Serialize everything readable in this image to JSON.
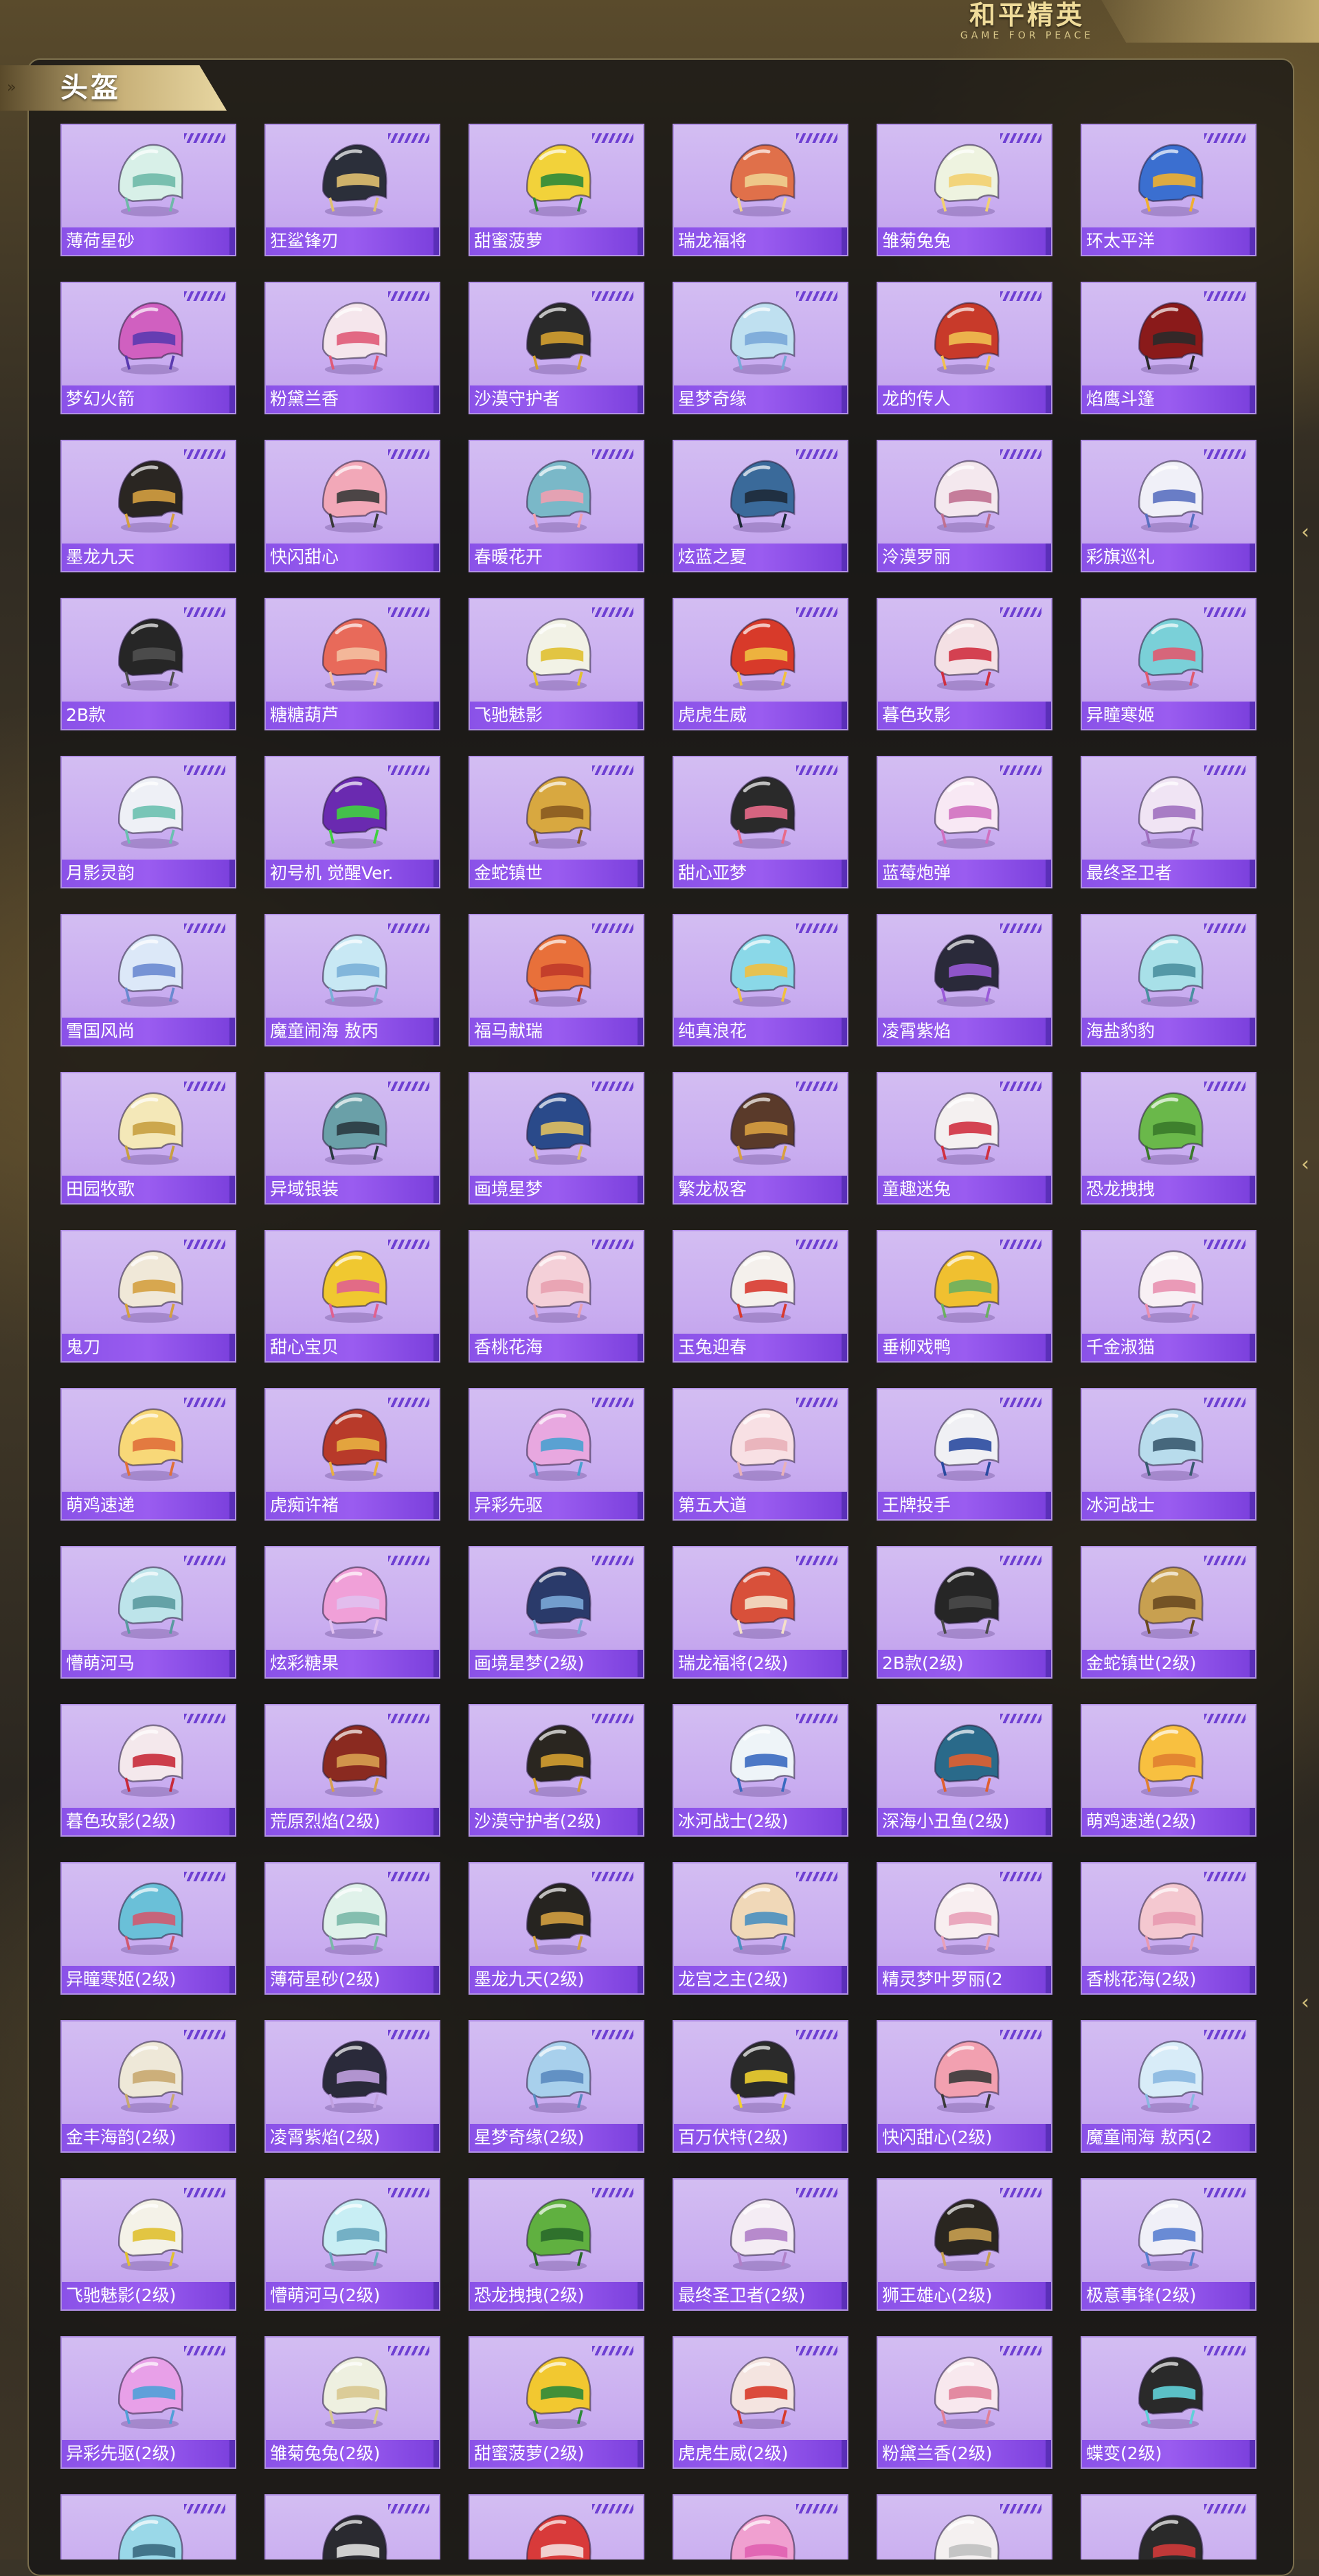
{
  "brand": {
    "logo_text": "和平精英",
    "logo_subtitle": "GAME FOR PEACE"
  },
  "section": {
    "title": "头盔"
  },
  "colors": {
    "card_bg": "#d3bdf2",
    "label_bar": "#8a52e8",
    "panel_border": "#c8b478",
    "tab_gold": "#c9b27a"
  },
  "items": [
    {
      "name": "薄荷星砂",
      "icon": "helmet-icon",
      "color": "#d8f0e8",
      "accent": "#6fb9a8"
    },
    {
      "name": "狂鲨锋刃",
      "icon": "helmet-icon",
      "color": "#2b2f3a",
      "accent": "#e0c070"
    },
    {
      "name": "甜蜜菠萝",
      "icon": "helmet-icon",
      "color": "#f2d23a",
      "accent": "#2e8a3a"
    },
    {
      "name": "瑞龙福将",
      "icon": "helmet-icon",
      "color": "#e0704a",
      "accent": "#f0d090"
    },
    {
      "name": "雏菊兔兔",
      "icon": "helmet-icon",
      "color": "#eef3e0",
      "accent": "#f2d070"
    },
    {
      "name": "环太平洋",
      "icon": "helmet-icon",
      "color": "#3b6fd0",
      "accent": "#f0b030"
    },
    {
      "name": "梦幻火箭",
      "icon": "helmet-icon",
      "color": "#d060c0",
      "accent": "#5a3ab0"
    },
    {
      "name": "粉黛兰香",
      "icon": "helmet-icon",
      "color": "#f5e6ec",
      "accent": "#e05a78"
    },
    {
      "name": "沙漠守护者",
      "icon": "helmet-icon",
      "color": "#2a2a2a",
      "accent": "#d4a030"
    },
    {
      "name": "星梦奇缘",
      "icon": "helmet-icon",
      "color": "#bfe0f0",
      "accent": "#7aa8d8"
    },
    {
      "name": "龙的传人",
      "icon": "helmet-icon",
      "color": "#c83a2a",
      "accent": "#f0c050"
    },
    {
      "name": "焰鹰斗篷",
      "icon": "helmet-icon",
      "color": "#8a1a1a",
      "accent": "#2a2a2a"
    },
    {
      "name": "墨龙九天",
      "icon": "helmet-icon",
      "color": "#2a2622",
      "accent": "#d4a040"
    },
    {
      "name": "快闪甜心",
      "icon": "helmet-icon",
      "color": "#f2a8b8",
      "accent": "#3a3a3a"
    },
    {
      "name": "春暖花开",
      "icon": "helmet-icon",
      "color": "#7ab8c8",
      "accent": "#f0a0b0"
    },
    {
      "name": "炫蓝之夏",
      "icon": "helmet-icon",
      "color": "#3a6a9a",
      "accent": "#1e2a38"
    },
    {
      "name": "泠漠罗丽",
      "icon": "helmet-icon",
      "color": "#f4e8ee",
      "accent": "#c07090"
    },
    {
      "name": "彩旗巡礼",
      "icon": "helmet-icon",
      "color": "#f0f0f8",
      "accent": "#5a70c0"
    },
    {
      "name": "2B款",
      "icon": "helmet-icon",
      "color": "#262626",
      "accent": "#505050"
    },
    {
      "name": "糖糖葫芦",
      "icon": "helmet-icon",
      "color": "#e86a5a",
      "accent": "#f4c0a0"
    },
    {
      "name": "飞驰魅影",
      "icon": "helmet-icon",
      "color": "#f2f2e6",
      "accent": "#e0c030"
    },
    {
      "name": "虎虎生威",
      "icon": "helmet-icon",
      "color": "#d83a2a",
      "accent": "#f0c040"
    },
    {
      "name": "暮色玫影",
      "icon": "helmet-icon",
      "color": "#f4e0e4",
      "accent": "#d03040"
    },
    {
      "name": "异瞳寒姬",
      "icon": "helmet-icon",
      "color": "#7ad0d8",
      "accent": "#e05a70"
    },
    {
      "name": "月影灵韵",
      "icon": "helmet-icon",
      "color": "#eef0f6",
      "accent": "#6ac0b0"
    },
    {
      "name": "初号机 觉醒Ver.",
      "icon": "helmet-icon",
      "color": "#6a2ab0",
      "accent": "#40d040"
    },
    {
      "name": "金蛇镇世",
      "icon": "helmet-icon",
      "color": "#d8a840",
      "accent": "#8a5a20"
    },
    {
      "name": "甜心亚梦",
      "icon": "helmet-icon",
      "color": "#2a2a2a",
      "accent": "#e86a8a"
    },
    {
      "name": "蓝莓炮弹",
      "icon": "helmet-icon",
      "color": "#f8e8f4",
      "accent": "#d070c0"
    },
    {
      "name": "最终圣卫者",
      "icon": "helmet-icon",
      "color": "#f0e4f4",
      "accent": "#a070c0"
    },
    {
      "name": "雪国风尚",
      "icon": "helmet-icon",
      "color": "#dce8f8",
      "accent": "#6a8ad0"
    },
    {
      "name": "魔童闹海 敖丙",
      "icon": "helmet-icon",
      "color": "#c8e8f4",
      "accent": "#7ab0d8"
    },
    {
      "name": "福马献瑞",
      "icon": "helmet-icon",
      "color": "#e8703a",
      "accent": "#c03a2a"
    },
    {
      "name": "纯真浪花",
      "icon": "helmet-icon",
      "color": "#8ad8e8",
      "accent": "#f0c040"
    },
    {
      "name": "凌霄紫焰",
      "icon": "helmet-icon",
      "color": "#2a2a3a",
      "accent": "#9a5ad8"
    },
    {
      "name": "海盐豹豹",
      "icon": "helmet-icon",
      "color": "#a8e0e8",
      "accent": "#4a90a0"
    },
    {
      "name": "田园牧歌",
      "icon": "helmet-icon",
      "color": "#f4e8b8",
      "accent": "#c8a040"
    },
    {
      "name": "异域银装",
      "icon": "helmet-icon",
      "color": "#6aa0a8",
      "accent": "#2a3a40"
    },
    {
      "name": "画境星梦",
      "icon": "helmet-icon",
      "color": "#2a4a8a",
      "accent": "#e0c060"
    },
    {
      "name": "繁龙极客",
      "icon": "helmet-icon",
      "color": "#5a3a2a",
      "accent": "#d8a040"
    },
    {
      "name": "童趣迷兔",
      "icon": "helmet-icon",
      "color": "#f4f0f0",
      "accent": "#d03040"
    },
    {
      "name": "恐龙拽拽",
      "icon": "helmet-icon",
      "color": "#6ab84a",
      "accent": "#3a7a2a"
    },
    {
      "name": "鬼刀",
      "icon": "helmet-icon",
      "color": "#f0e8d8",
      "accent": "#d4a040"
    },
    {
      "name": "甜心宝贝",
      "icon": "helmet-icon",
      "color": "#f0c830",
      "accent": "#e06090"
    },
    {
      "name": "香桃花海",
      "icon": "helmet-icon",
      "color": "#f4d0d8",
      "accent": "#e8a0b0"
    },
    {
      "name": "玉兔迎春",
      "icon": "helmet-icon",
      "color": "#f4f0ec",
      "accent": "#d83a30"
    },
    {
      "name": "垂柳戏鸭",
      "icon": "helmet-icon",
      "color": "#f0c030",
      "accent": "#6ab060"
    },
    {
      "name": "千金淑猫",
      "icon": "helmet-icon",
      "color": "#f8f0f4",
      "accent": "#e890b0"
    },
    {
      "name": "萌鸡速递",
      "icon": "helmet-icon",
      "color": "#f8d878",
      "accent": "#e0703a"
    },
    {
      "name": "虎痴许褚",
      "icon": "helmet-icon",
      "color": "#b83a2a",
      "accent": "#e8b040"
    },
    {
      "name": "异彩先驱",
      "icon": "helmet-icon",
      "color": "#e8a8e0",
      "accent": "#4aa0d0"
    },
    {
      "name": "第五大道",
      "icon": "helmet-icon",
      "color": "#f8e0e4",
      "accent": "#e8b0b8"
    },
    {
      "name": "王牌投手",
      "icon": "helmet-icon",
      "color": "#f0f0f4",
      "accent": "#2a4aa0"
    },
    {
      "name": "冰河战士",
      "icon": "helmet-icon",
      "color": "#b8dcec",
      "accent": "#3a5a70"
    },
    {
      "name": "懵萌河马",
      "icon": "helmet-icon",
      "color": "#bde4ea",
      "accent": "#5a9aa0"
    },
    {
      "name": "炫彩糖果",
      "icon": "helmet-icon",
      "color": "#f0a0d8",
      "accent": "#e0c0f0"
    },
    {
      "name": "画境星梦(2级)",
      "icon": "helmet-icon",
      "color": "#2a3a6a",
      "accent": "#7aa8d8"
    },
    {
      "name": "瑞龙福将(2级)",
      "icon": "helmet-icon",
      "color": "#d8503a",
      "accent": "#f4e0c8"
    },
    {
      "name": "2B款(2级)",
      "icon": "helmet-icon",
      "color": "#262626",
      "accent": "#4a4a4a"
    },
    {
      "name": "金蛇镇世(2级)",
      "icon": "helmet-icon",
      "color": "#c8a050",
      "accent": "#6a4a20"
    },
    {
      "name": "暮色玫影(2级)",
      "icon": "helmet-icon",
      "color": "#f4e8ec",
      "accent": "#c82a3a"
    },
    {
      "name": "荒原烈焰(2级)",
      "icon": "helmet-icon",
      "color": "#8a2a20",
      "accent": "#d8a050"
    },
    {
      "name": "沙漠守护者(2级)",
      "icon": "helmet-icon",
      "color": "#2a2620",
      "accent": "#d4a030"
    },
    {
      "name": "冰河战士(2级)",
      "icon": "helmet-icon",
      "color": "#eef4f8",
      "accent": "#3a6ac0"
    },
    {
      "name": "深海小丑鱼(2级)",
      "icon": "helmet-icon",
      "color": "#2a6a8a",
      "accent": "#e06030"
    },
    {
      "name": "萌鸡速递(2级)",
      "icon": "helmet-icon",
      "color": "#f8c040",
      "accent": "#e08030"
    },
    {
      "name": "异瞳寒姬(2级)",
      "icon": "helmet-icon",
      "color": "#6ac0d8",
      "accent": "#d05a70"
    },
    {
      "name": "薄荷星砂(2级)",
      "icon": "helmet-icon",
      "color": "#e0f2ea",
      "accent": "#7ab8a8"
    },
    {
      "name": "墨龙九天(2级)",
      "icon": "helmet-icon",
      "color": "#262420",
      "accent": "#d4a040"
    },
    {
      "name": "龙宫之主(2级)",
      "icon": "helmet-icon",
      "color": "#f0d8b8",
      "accent": "#4a90c0"
    },
    {
      "name": "精灵梦叶罗丽(2",
      "icon": "helmet-icon",
      "color": "#f8eef0",
      "accent": "#e8a0b8"
    },
    {
      "name": "香桃花海(2级)",
      "icon": "helmet-icon",
      "color": "#f4c8d0",
      "accent": "#e89ab0"
    },
    {
      "name": "金丰海韵(2级)",
      "icon": "helmet-icon",
      "color": "#eee8d8",
      "accent": "#c8a870"
    },
    {
      "name": "凌霄紫焰(2级)",
      "icon": "helmet-icon",
      "color": "#2a2a3a",
      "accent": "#c0a0e0"
    },
    {
      "name": "星梦奇缘(2级)",
      "icon": "helmet-icon",
      "color": "#a8d0ec",
      "accent": "#5a8ac0"
    },
    {
      "name": "百万伏特(2级)",
      "icon": "helmet-icon",
      "color": "#2a2a2a",
      "accent": "#f0d030"
    },
    {
      "name": "快闪甜心(2级)",
      "icon": "helmet-icon",
      "color": "#f2a0b0",
      "accent": "#3a3a3a"
    },
    {
      "name": "魔童闹海 敖丙(2",
      "icon": "helmet-icon",
      "color": "#d8ecf8",
      "accent": "#8ab8e0"
    },
    {
      "name": "飞驰魅影(2级)",
      "icon": "helmet-icon",
      "color": "#f4f2e8",
      "accent": "#e0c030"
    },
    {
      "name": "懵萌河马(2级)",
      "icon": "helmet-icon",
      "color": "#c8eef4",
      "accent": "#6aa8c0"
    },
    {
      "name": "恐龙拽拽(2级)",
      "icon": "helmet-icon",
      "color": "#60b040",
      "accent": "#2a6a2a"
    },
    {
      "name": "最终圣卫者(2级)",
      "icon": "helmet-icon",
      "color": "#f4ecf4",
      "accent": "#b080c8"
    },
    {
      "name": "狮王雄心(2级)",
      "icon": "helmet-icon",
      "color": "#2a2620",
      "accent": "#c8a050"
    },
    {
      "name": "极意事锋(2级)",
      "icon": "helmet-icon",
      "color": "#f0f0f8",
      "accent": "#5a80d0"
    },
    {
      "name": "异彩先驱(2级)",
      "icon": "helmet-icon",
      "color": "#e8a0e8",
      "accent": "#50a0d8"
    },
    {
      "name": "雏菊兔兔(2级)",
      "icon": "helmet-icon",
      "color": "#eef0e0",
      "accent": "#d8c890"
    },
    {
      "name": "甜蜜菠萝(2级)",
      "icon": "helmet-icon",
      "color": "#f2c830",
      "accent": "#2e8a3a"
    },
    {
      "name": "虎虎生威(2级)",
      "icon": "helmet-icon",
      "color": "#f4e4e0",
      "accent": "#d83a2a"
    },
    {
      "name": "粉黛兰香(2级)",
      "icon": "helmet-icon",
      "color": "#f8e8ee",
      "accent": "#e08098"
    },
    {
      "name": "蝶变(2级)",
      "icon": "helmet-icon",
      "color": "#2a2a2a",
      "accent": "#60d0d8"
    },
    {
      "name": "",
      "icon": "helmet-icon",
      "color": "#9ad8e8",
      "accent": "#3a6a80"
    },
    {
      "name": "",
      "icon": "helmet-icon",
      "color": "#2a2a30",
      "accent": "#e0e0e0"
    },
    {
      "name": "",
      "icon": "helmet-icon",
      "color": "#d83a3a",
      "accent": "#f4e0e0"
    },
    {
      "name": "",
      "icon": "helmet-icon",
      "color": "#f0a0d0",
      "accent": "#e060b0"
    },
    {
      "name": "",
      "icon": "helmet-icon",
      "color": "#f4f0f0",
      "accent": "#c0c0c0"
    },
    {
      "name": "",
      "icon": "helmet-icon",
      "color": "#2a2a2a",
      "accent": "#d03a3a"
    }
  ]
}
